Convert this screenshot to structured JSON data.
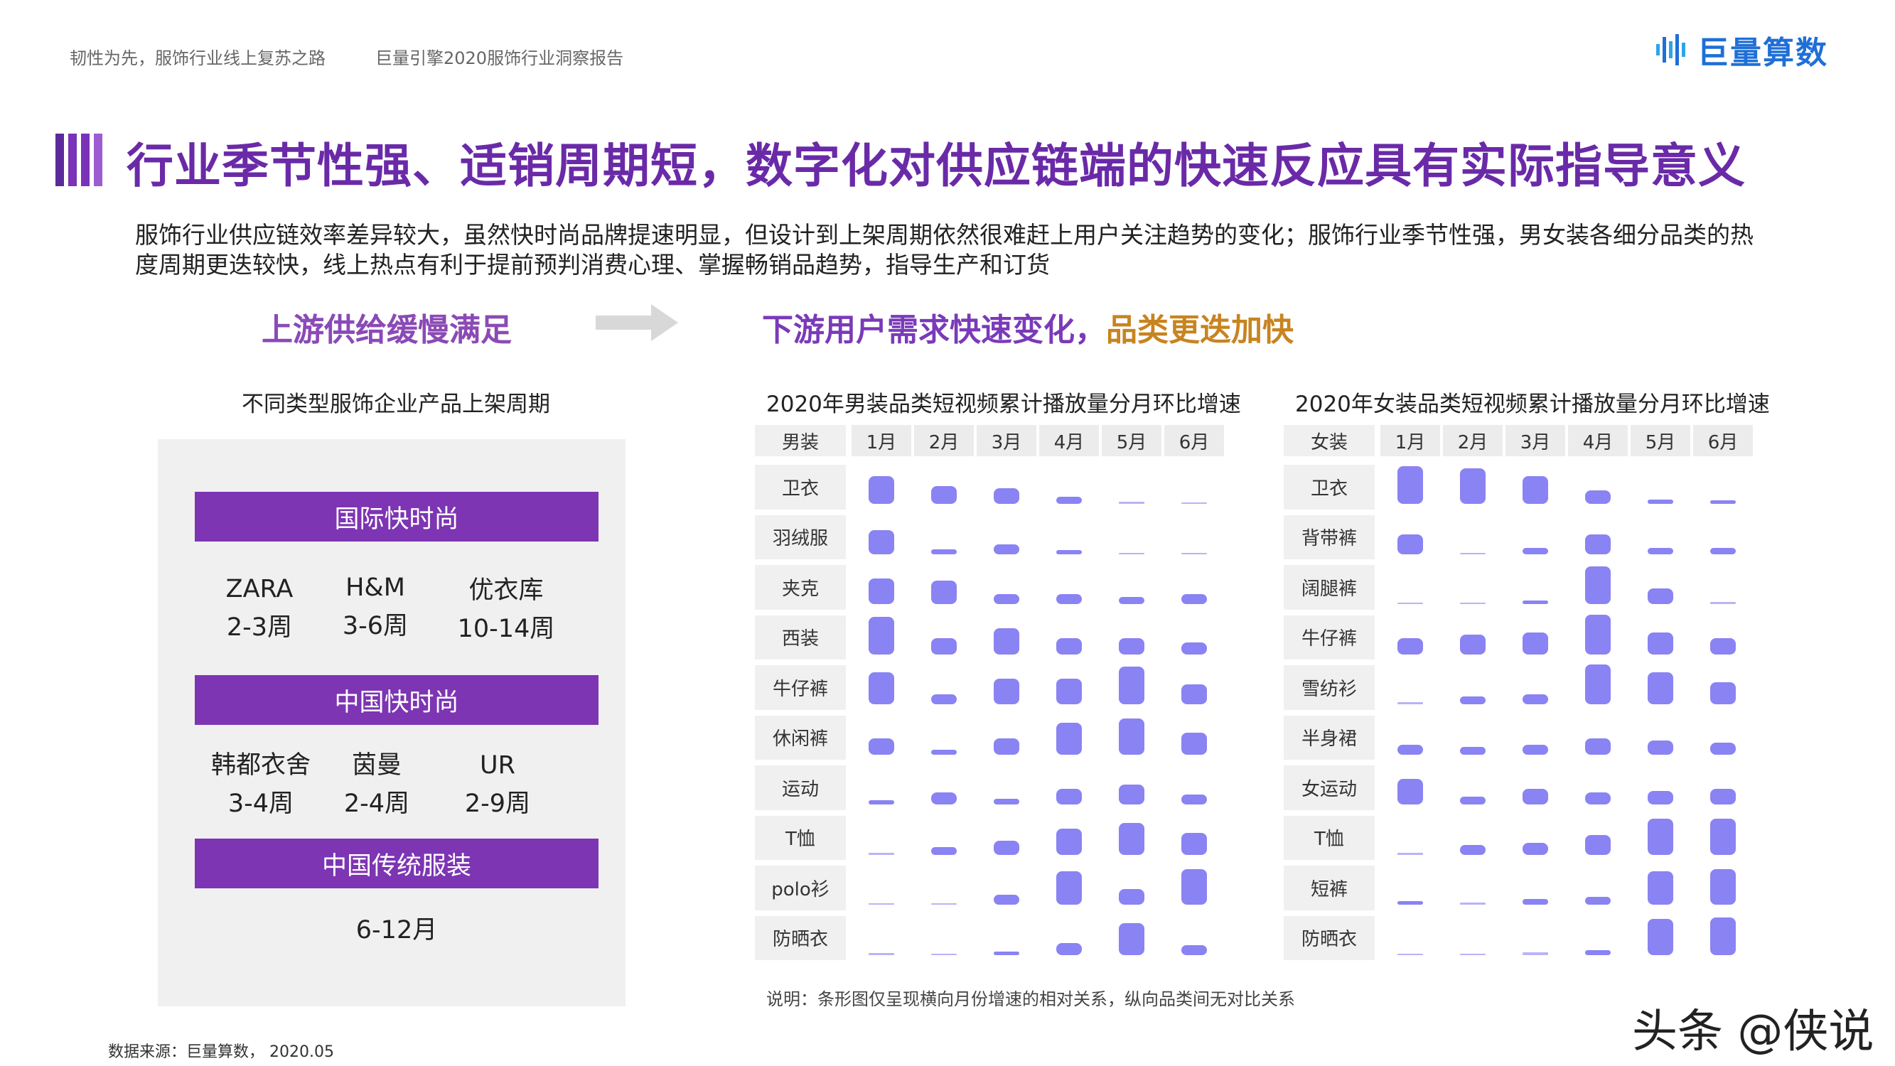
{
  "header": {
    "left_text": "韧性为先，服饰行业线上复苏之路",
    "report_text": "巨量引擎2020服饰行业洞察报告",
    "logo_text": "巨量算数"
  },
  "title": "行业季节性强、适销周期短，数字化对供应链端的快速反应具有实际指导意义",
  "description": "服饰行业供应链效率差异较大，虽然快时尚品牌提速明显，但设计到上架周期依然很难赶上用户关注趋势的变化；服饰行业季节性强，男女装各细分品类的热度周期更迭较快，线上热点有利于提前预判消费心理、掌握畅销品趋势，指导生产和订货",
  "left_heading": "上游供给缓慢满足",
  "right_heading_part1": "下游用户需求快速变化，",
  "right_heading_part2": "品类更迭加快",
  "left_panel": {
    "title": "不同类型服饰企业产品上架周期",
    "groups": [
      {
        "name": "国际快时尚",
        "brands": [
          {
            "name": "ZARA",
            "period": "2-3周"
          },
          {
            "name": "H&M",
            "period": "3-6周"
          },
          {
            "name": "优衣库",
            "period": "10-14周"
          }
        ]
      },
      {
        "name": "中国快时尚",
        "brands": [
          {
            "name": "韩都衣舍",
            "period": "3-4周"
          },
          {
            "name": "茵曼",
            "period": "2-4周"
          },
          {
            "name": "UR",
            "period": "2-9周"
          }
        ]
      },
      {
        "name": "中国传统服装",
        "brands": [
          {
            "name": "",
            "period": "6-12月"
          }
        ]
      }
    ]
  },
  "chart_data": [
    {
      "type": "heatmap",
      "title": "2020年男装品类短视频累计播放量分月环比增速",
      "corner_label": "男装",
      "months": [
        "1月",
        "2月",
        "3月",
        "4月",
        "5月",
        "6月"
      ],
      "rows": [
        "卫衣",
        "羽绒服",
        "夹克",
        "西装",
        "牛仔裤",
        "休闲裤",
        "运动",
        "T恤",
        "polo衫",
        "防晒衣"
      ],
      "values": [
        [
          0.7,
          0.45,
          0.4,
          0.18,
          0.05,
          0.04
        ],
        [
          0.6,
          0.12,
          0.25,
          0.1,
          0.04,
          0.04
        ],
        [
          0.65,
          0.6,
          0.25,
          0.25,
          0.18,
          0.25
        ],
        [
          0.95,
          0.4,
          0.65,
          0.4,
          0.4,
          0.3
        ],
        [
          0.8,
          0.25,
          0.65,
          0.65,
          0.95,
          0.5
        ],
        [
          0.4,
          0.12,
          0.4,
          0.8,
          0.9,
          0.55
        ],
        [
          0.12,
          0.3,
          0.15,
          0.4,
          0.5,
          0.25
        ],
        [
          0.05,
          0.2,
          0.35,
          0.65,
          0.8,
          0.55
        ],
        [
          0.04,
          0.04,
          0.25,
          0.85,
          0.4,
          0.9
        ],
        [
          0.05,
          0.04,
          0.08,
          0.3,
          0.8,
          0.25
        ]
      ],
      "note": "说明：条形图仅呈现横向月份增速的相对关系，纵向品类间无对比关系"
    },
    {
      "type": "heatmap",
      "title": "2020年女装品类短视频累计播放量分月环比增速",
      "corner_label": "女装",
      "months": [
        "1月",
        "2月",
        "3月",
        "4月",
        "5月",
        "6月"
      ],
      "rows": [
        "卫衣",
        "背带裤",
        "阔腿裤",
        "牛仔裤",
        "雪纺衫",
        "半身裙",
        "女运动",
        "T恤",
        "短裤",
        "防晒衣"
      ],
      "values": [
        [
          0.95,
          0.9,
          0.7,
          0.35,
          0.12,
          0.1
        ],
        [
          0.5,
          0.04,
          0.15,
          0.5,
          0.15,
          0.15
        ],
        [
          0.04,
          0.04,
          0.1,
          0.95,
          0.4,
          0.06
        ],
        [
          0.4,
          0.5,
          0.55,
          1.0,
          0.55,
          0.4
        ],
        [
          0.05,
          0.2,
          0.25,
          1.0,
          0.8,
          0.55
        ],
        [
          0.25,
          0.2,
          0.25,
          0.4,
          0.35,
          0.3
        ],
        [
          0.65,
          0.2,
          0.4,
          0.3,
          0.35,
          0.4
        ],
        [
          0.05,
          0.25,
          0.3,
          0.5,
          0.9,
          0.9
        ],
        [
          0.1,
          0.06,
          0.15,
          0.2,
          0.85,
          0.9
        ],
        [
          0.04,
          0.04,
          0.06,
          0.12,
          0.9,
          0.95
        ]
      ]
    }
  ],
  "source": "数据来源：巨量算数， 2020.05",
  "watermark": "头条 @侠说",
  "colors": {
    "accent": "#7d35b3",
    "mark": "#8a83f3",
    "title": "#6a2aa8"
  }
}
